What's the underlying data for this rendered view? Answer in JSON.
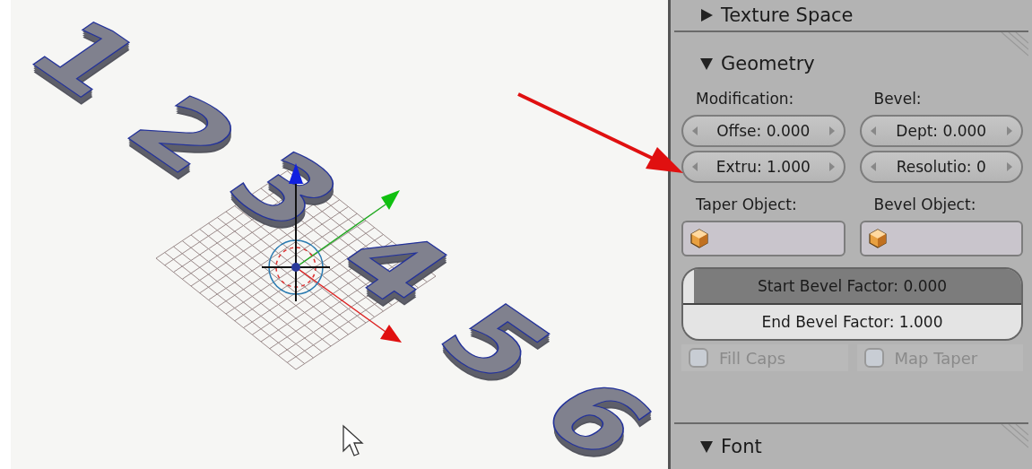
{
  "viewport": {
    "objects": [
      "1",
      "2",
      "3",
      "4",
      "5",
      "6"
    ]
  },
  "texture_space": {
    "title": "Texture Space",
    "expanded": false
  },
  "geometry": {
    "title": "Geometry",
    "expanded": true,
    "columns": [
      {
        "label": "Modification:",
        "fields": [
          "Offse: 0.000",
          "Extru: 1.000"
        ],
        "object_label": "Taper Object:"
      },
      {
        "label": "Bevel:",
        "fields": [
          "Dept: 0.000",
          "Resolutio: 0"
        ],
        "object_label": "Bevel Object:"
      }
    ],
    "sliders": [
      {
        "label": "Start Bevel Factor: 0.000",
        "level": 0
      },
      {
        "label": "End Bevel Factor: 1.000",
        "level": 1
      }
    ],
    "checkboxes": [
      {
        "label": "Fill Caps",
        "checked": false,
        "disabled": true
      },
      {
        "label": "Map Taper",
        "checked": false,
        "disabled": true
      }
    ]
  },
  "font": {
    "title": "Font",
    "expanded": true
  }
}
